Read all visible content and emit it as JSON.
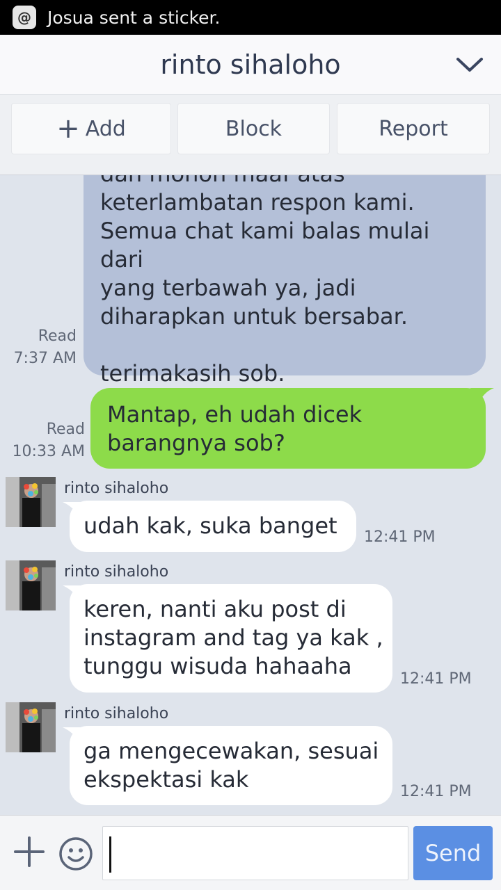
{
  "notification": {
    "text": "Josua sent a sticker.",
    "icon": "at-sign-icon"
  },
  "header": {
    "title": "rinto sihaloho"
  },
  "actions": {
    "add_label": "Add",
    "block_label": "Block",
    "report_label": "Report"
  },
  "messages": [
    {
      "direction": "sent",
      "text": "dan mohon maaf atas\nketerlambatan respon kami.\nSemua chat kami balas mulai dari\nyang terbawah ya, jadi\ndiharapkan untuk bersabar.\n\nterimakasih sob.",
      "status": "Read",
      "time": "7:37 AM"
    },
    {
      "direction": "sent",
      "text": "Mantap, eh udah dicek\nbarangnya sob?",
      "status": "Read",
      "time": "10:33 AM"
    },
    {
      "direction": "received",
      "sender": "rinto sihaloho",
      "text": "udah kak, suka banget",
      "time": "12:41 PM"
    },
    {
      "direction": "received",
      "sender": "rinto sihaloho",
      "text": "keren, nanti aku post di\ninstagram and tag ya kak ,\ntunggu wisuda hahaaha",
      "time": "12:41 PM"
    },
    {
      "direction": "received",
      "sender": "rinto sihaloho",
      "text": "ga mengecewakan, sesuai\nekspektasi kak",
      "time": "12:41 PM"
    }
  ],
  "composer": {
    "value": "",
    "send_label": "Send"
  },
  "colors": {
    "sent_bubble": "#b4c0d8",
    "green_bubble": "#8ddb4a",
    "send_button": "#5b8fe3",
    "chat_background": "#dfe4ec"
  }
}
